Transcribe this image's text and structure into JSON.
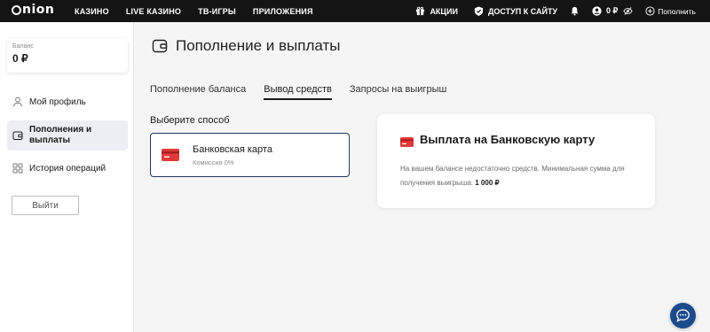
{
  "brand": {
    "logo_text": "nion"
  },
  "topnav": {
    "items": [
      "КАЗИНО",
      "LIVE КАЗИНО",
      "ТВ-ИГРЫ",
      "ПРИЛОЖЕНИЯ"
    ],
    "promos_label": "АКЦИИ",
    "site_access_label": "ДОСТУП К САЙТУ",
    "balance": "0 ₽",
    "deposit_label": "Пополнить"
  },
  "sidebar": {
    "balance_label": "Баланс",
    "balance_value": "0 ₽",
    "items": [
      {
        "label": "Мой профиль",
        "icon": "user-icon"
      },
      {
        "label": "Пополнения и выплаты",
        "icon": "wallet-icon",
        "active": true
      },
      {
        "label": "История операций",
        "icon": "grid-icon"
      }
    ],
    "logout_label": "Выйти"
  },
  "main": {
    "title": "Пополнение и выплаты",
    "tabs": [
      {
        "label": "Пополнение баланса"
      },
      {
        "label": "Вывод средств",
        "active": true
      },
      {
        "label": "Запросы на выигрыш"
      }
    ],
    "choose_label": "Выберите способ",
    "method": {
      "name": "Банковская карта",
      "fee": "Комиссия 0%"
    },
    "info": {
      "title": "Выплата на Банковскую карту",
      "text": "На вашем балансе недостаточно средств. Минимальная сумма для получения выигрыша:",
      "min_amount": "1 000 ₽"
    }
  },
  "colors": {
    "topbar": "#141414",
    "accent": "#1c4b8c",
    "card_red": "#e03a3a"
  }
}
